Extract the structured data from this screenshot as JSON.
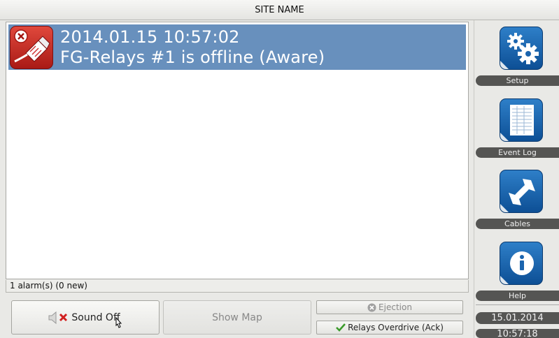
{
  "window": {
    "title": "SITE NAME"
  },
  "alarms": [
    {
      "datetime": "2014.01.15 10:57:02",
      "message": "FG-Relays #1 is offline (Aware)",
      "icon": "relay-offline-icon"
    }
  ],
  "status": {
    "summary": "1 alarm(s) (0 new)"
  },
  "sidebar": {
    "items": [
      {
        "label": "Setup",
        "icon": "gears-icon"
      },
      {
        "label": "Event Log",
        "icon": "document-icon"
      },
      {
        "label": "Cables",
        "icon": "cable-arrows-icon"
      },
      {
        "label": "Help",
        "icon": "info-icon"
      }
    ]
  },
  "buttons": {
    "sound_off": "Sound Off",
    "show_map": "Show Map",
    "ejection": "Ejection",
    "relays_overdrive": "Relays Overdrive (Ack)"
  },
  "clock": {
    "date": "15.01.2014",
    "time": "10:57:18"
  },
  "colors": {
    "selection": "#6890bd",
    "alarm_icon": "#c42a22",
    "side_icon": "#1a64ae",
    "pill": "#555553"
  }
}
